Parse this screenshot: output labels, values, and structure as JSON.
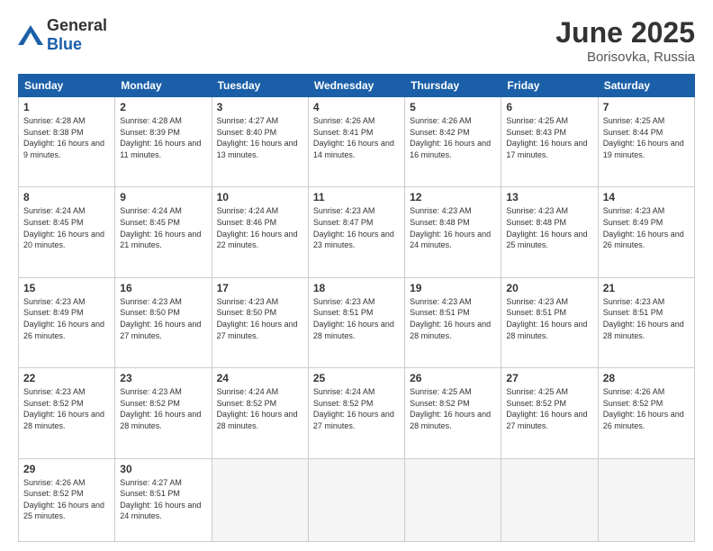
{
  "header": {
    "logo_general": "General",
    "logo_blue": "Blue",
    "month_year": "June 2025",
    "location": "Borisovka, Russia"
  },
  "weekdays": [
    "Sunday",
    "Monday",
    "Tuesday",
    "Wednesday",
    "Thursday",
    "Friday",
    "Saturday"
  ],
  "weeks": [
    [
      {
        "day": "1",
        "sunrise": "4:28 AM",
        "sunset": "8:38 PM",
        "daylight": "16 hours and 9 minutes."
      },
      {
        "day": "2",
        "sunrise": "4:28 AM",
        "sunset": "8:39 PM",
        "daylight": "16 hours and 11 minutes."
      },
      {
        "day": "3",
        "sunrise": "4:27 AM",
        "sunset": "8:40 PM",
        "daylight": "16 hours and 13 minutes."
      },
      {
        "day": "4",
        "sunrise": "4:26 AM",
        "sunset": "8:41 PM",
        "daylight": "16 hours and 14 minutes."
      },
      {
        "day": "5",
        "sunrise": "4:26 AM",
        "sunset": "8:42 PM",
        "daylight": "16 hours and 16 minutes."
      },
      {
        "day": "6",
        "sunrise": "4:25 AM",
        "sunset": "8:43 PM",
        "daylight": "16 hours and 17 minutes."
      },
      {
        "day": "7",
        "sunrise": "4:25 AM",
        "sunset": "8:44 PM",
        "daylight": "16 hours and 19 minutes."
      }
    ],
    [
      {
        "day": "8",
        "sunrise": "4:24 AM",
        "sunset": "8:45 PM",
        "daylight": "16 hours and 20 minutes."
      },
      {
        "day": "9",
        "sunrise": "4:24 AM",
        "sunset": "8:45 PM",
        "daylight": "16 hours and 21 minutes."
      },
      {
        "day": "10",
        "sunrise": "4:24 AM",
        "sunset": "8:46 PM",
        "daylight": "16 hours and 22 minutes."
      },
      {
        "day": "11",
        "sunrise": "4:23 AM",
        "sunset": "8:47 PM",
        "daylight": "16 hours and 23 minutes."
      },
      {
        "day": "12",
        "sunrise": "4:23 AM",
        "sunset": "8:48 PM",
        "daylight": "16 hours and 24 minutes."
      },
      {
        "day": "13",
        "sunrise": "4:23 AM",
        "sunset": "8:48 PM",
        "daylight": "16 hours and 25 minutes."
      },
      {
        "day": "14",
        "sunrise": "4:23 AM",
        "sunset": "8:49 PM",
        "daylight": "16 hours and 26 minutes."
      }
    ],
    [
      {
        "day": "15",
        "sunrise": "4:23 AM",
        "sunset": "8:49 PM",
        "daylight": "16 hours and 26 minutes."
      },
      {
        "day": "16",
        "sunrise": "4:23 AM",
        "sunset": "8:50 PM",
        "daylight": "16 hours and 27 minutes."
      },
      {
        "day": "17",
        "sunrise": "4:23 AM",
        "sunset": "8:50 PM",
        "daylight": "16 hours and 27 minutes."
      },
      {
        "day": "18",
        "sunrise": "4:23 AM",
        "sunset": "8:51 PM",
        "daylight": "16 hours and 28 minutes."
      },
      {
        "day": "19",
        "sunrise": "4:23 AM",
        "sunset": "8:51 PM",
        "daylight": "16 hours and 28 minutes."
      },
      {
        "day": "20",
        "sunrise": "4:23 AM",
        "sunset": "8:51 PM",
        "daylight": "16 hours and 28 minutes."
      },
      {
        "day": "21",
        "sunrise": "4:23 AM",
        "sunset": "8:51 PM",
        "daylight": "16 hours and 28 minutes."
      }
    ],
    [
      {
        "day": "22",
        "sunrise": "4:23 AM",
        "sunset": "8:52 PM",
        "daylight": "16 hours and 28 minutes."
      },
      {
        "day": "23",
        "sunrise": "4:23 AM",
        "sunset": "8:52 PM",
        "daylight": "16 hours and 28 minutes."
      },
      {
        "day": "24",
        "sunrise": "4:24 AM",
        "sunset": "8:52 PM",
        "daylight": "16 hours and 28 minutes."
      },
      {
        "day": "25",
        "sunrise": "4:24 AM",
        "sunset": "8:52 PM",
        "daylight": "16 hours and 27 minutes."
      },
      {
        "day": "26",
        "sunrise": "4:25 AM",
        "sunset": "8:52 PM",
        "daylight": "16 hours and 28 minutes."
      },
      {
        "day": "27",
        "sunrise": "4:25 AM",
        "sunset": "8:52 PM",
        "daylight": "16 hours and 27 minutes."
      },
      {
        "day": "28",
        "sunrise": "4:26 AM",
        "sunset": "8:52 PM",
        "daylight": "16 hours and 26 minutes."
      }
    ],
    [
      {
        "day": "29",
        "sunrise": "4:26 AM",
        "sunset": "8:52 PM",
        "daylight": "16 hours and 25 minutes."
      },
      {
        "day": "30",
        "sunrise": "4:27 AM",
        "sunset": "8:51 PM",
        "daylight": "16 hours and 24 minutes."
      },
      null,
      null,
      null,
      null,
      null
    ]
  ]
}
